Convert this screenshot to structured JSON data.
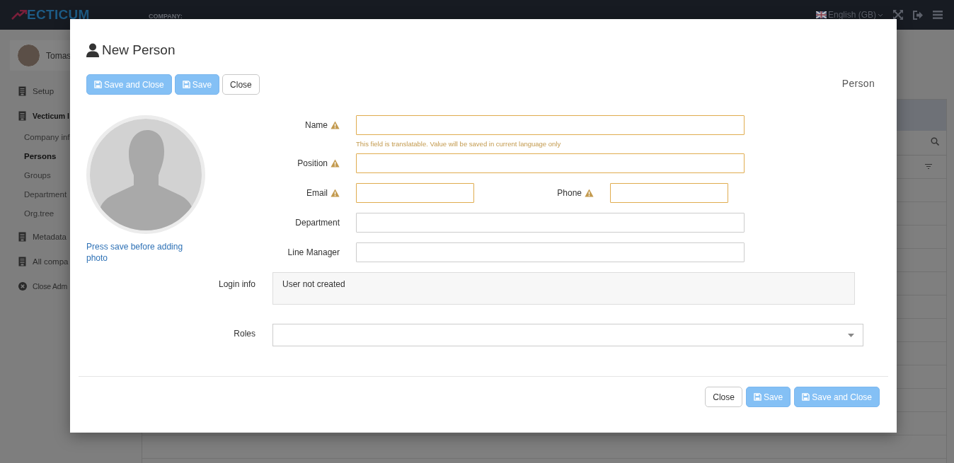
{
  "topbar": {
    "logo": "ECTICUM",
    "company_label": "COMPANY:",
    "language": "English (GB)"
  },
  "sidebar": {
    "user": "Tomas",
    "nav": [
      {
        "kind": "section",
        "label": "Setup",
        "expanded": false
      },
      {
        "kind": "section",
        "label": "Vecticum I",
        "expanded": true,
        "children": [
          {
            "label": "Company inf",
            "selected": false
          },
          {
            "label": "Persons",
            "selected": true
          },
          {
            "label": "Groups",
            "selected": false
          },
          {
            "label": "Department",
            "selected": false
          },
          {
            "label": "Org.tree",
            "selected": false
          }
        ]
      },
      {
        "kind": "section",
        "label": "Metadata",
        "expanded": false
      },
      {
        "kind": "section",
        "label": "All compa",
        "expanded": false
      },
      {
        "kind": "action",
        "label": "Close Adm"
      }
    ]
  },
  "modal": {
    "title": "New Person",
    "type_label": "Person",
    "photo_hint": "Press save before adding photo",
    "top_buttons": [
      {
        "label": "Save and Close",
        "kind": "primary"
      },
      {
        "label": "Save",
        "kind": "primary"
      },
      {
        "label": "Close",
        "kind": "default"
      }
    ],
    "fields": [
      {
        "kind": "text",
        "label": "Name",
        "required": true,
        "hint": "This field is translatable. Value will be saved in current language only"
      },
      {
        "kind": "text",
        "label": "Position",
        "required": true
      },
      {
        "kind": "pair",
        "items": [
          {
            "label": "Email",
            "required": true
          },
          {
            "label": "Phone",
            "required": true
          }
        ]
      },
      {
        "kind": "text",
        "label": "Department",
        "required": false
      },
      {
        "kind": "text",
        "label": "Line Manager",
        "required": false
      }
    ],
    "login_info": {
      "label": "Login info",
      "value": "User not created"
    },
    "roles": {
      "label": "Roles"
    },
    "footer_buttons": [
      {
        "label": "Close",
        "kind": "default"
      },
      {
        "label": "Save",
        "kind": "primary"
      },
      {
        "label": "Save and Close",
        "kind": "primary"
      }
    ]
  }
}
